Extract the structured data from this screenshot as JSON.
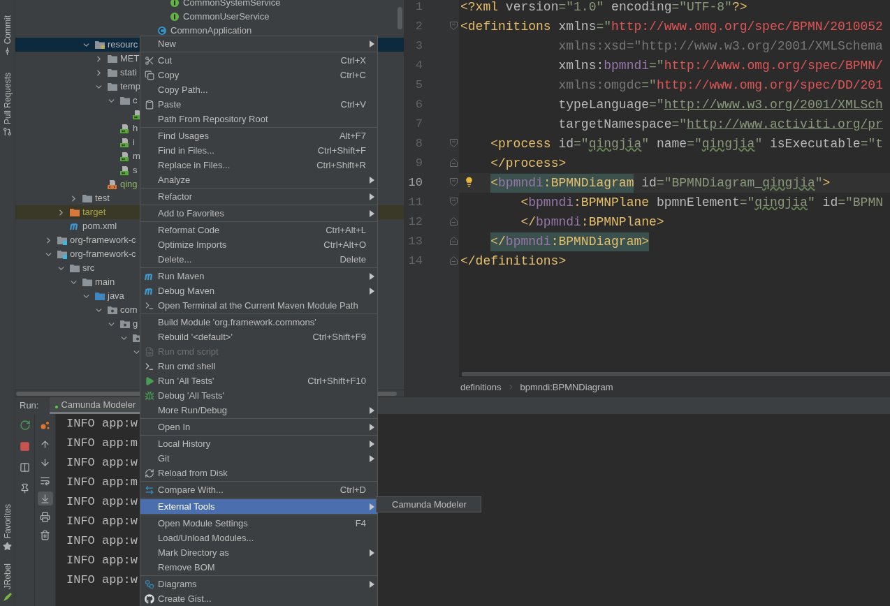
{
  "tool_windows": {
    "top": [
      "Commit",
      "Pull Requests"
    ],
    "bottom": [
      "Favorites",
      "JRebel"
    ]
  },
  "tree": {
    "items": [
      {
        "children": [
          {
            "children": [
              {
                "children": [
                  {
                    "children": [
                      {
                        "children": [
                          {
                            "children": [
                              {
                                "children": [
                                  {
                                    "children": [
                                      {
                                        "children": [
                                          {
                                            "text": "CommonSystemService",
                                            "kind": "interface",
                                            "selected": false
                                          },
                                          {
                                            "text": "CommonUserService",
                                            "kind": "interface",
                                            "selected": false
                                          }
                                        ]
                                      },
                                      {
                                        "text": "CommonApplication",
                                        "kind": "class",
                                        "selected": false
                                      }
                                    ]
                                  }
                                ]
                              }
                            ]
                          }
                        ]
                      }
                    ]
                  },
                  {
                    "text": "resourc",
                    "kind": "resources",
                    "expanded": true,
                    "selected": true,
                    "children": [
                      {
                        "text": "MET",
                        "kind": "folder",
                        "expanded": false,
                        "selected": false
                      },
                      {
                        "text": "stati",
                        "kind": "folder",
                        "expanded": false,
                        "selected": false
                      },
                      {
                        "text": "temp",
                        "kind": "folder",
                        "expanded": true,
                        "selected": false,
                        "children": [
                          {
                            "text": "c",
                            "kind": "folder",
                            "expanded": true,
                            "selected": false,
                            "children": [
                              {
                                "kind": "html",
                                "selected": false
                              }
                            ]
                          },
                          {
                            "text": "h",
                            "kind": "html",
                            "selected": false
                          },
                          {
                            "text": "i",
                            "kind": "html",
                            "selected": false
                          },
                          {
                            "text": "m",
                            "kind": "html",
                            "selected": false
                          },
                          {
                            "text": "s",
                            "kind": "html",
                            "selected": false
                          }
                        ]
                      },
                      {
                        "text": "qing",
                        "kind": "xml",
                        "color": "#8fb36a",
                        "selected": false
                      }
                    ]
                  }
                ]
              },
              {
                "text": "test",
                "kind": "folder",
                "expanded": false,
                "selected": false
              }
            ]
          },
          {
            "text": "target",
            "kind": "excluded",
            "expanded": false,
            "selected": false
          },
          {
            "text": "pom.xml",
            "kind": "maven",
            "selected": false
          }
        ]
      },
      {
        "text": "org-framework-c",
        "kind": "module",
        "expanded": false,
        "selected": false
      },
      {
        "text": "org-framework-c",
        "kind": "module",
        "expanded": true,
        "selected": false,
        "children": [
          {
            "text": "src",
            "kind": "folder",
            "expanded": true,
            "selected": false,
            "children": [
              {
                "text": "main",
                "kind": "folder",
                "expanded": true,
                "selected": false,
                "children": [
                  {
                    "text": "java",
                    "kind": "source",
                    "expanded": true,
                    "selected": false,
                    "children": [
                      {
                        "text": "com",
                        "kind": "package",
                        "expanded": true,
                        "selected": false,
                        "children": [
                          {
                            "text": "g",
                            "kind": "package",
                            "expanded": true,
                            "selected": false,
                            "children": [
                              {
                                "kind": "package",
                                "expanded": true,
                                "selected": false,
                                "children": [
                                  {
                                    "expanded": true,
                                    "selected": false
                                  }
                                ]
                              }
                            ]
                          }
                        ]
                      }
                    ]
                  }
                ]
              }
            ]
          }
        ]
      }
    ]
  },
  "editor": {
    "lines": [
      {
        "number": "1",
        "fold_open": false,
        "fold_close": false,
        "current": false,
        "bulb": false,
        "tokens": [
          {
            "text": "<?xml",
            "kind": "tag"
          },
          {
            "text": " version",
            "kind": "attr"
          },
          {
            "text": "=\"1.0\"",
            "kind": "value"
          },
          {
            "text": " encoding",
            "kind": "attr"
          },
          {
            "text": "=\"UTF-8\"",
            "kind": "value"
          },
          {
            "text": "?>",
            "kind": "tag"
          }
        ]
      },
      {
        "number": "2",
        "fold_open": true,
        "fold_close": false,
        "current": false,
        "bulb": false,
        "tokens": [
          {
            "text": "<definitions",
            "kind": "tag"
          },
          {
            "text": " xmlns",
            "kind": "attr"
          },
          {
            "text": "=\"",
            "kind": "value"
          },
          {
            "text": "http://www.omg.org/spec/BPMN/2010052",
            "kind": "url_error"
          }
        ]
      },
      {
        "number": "3",
        "fold_open": false,
        "fold_close": false,
        "current": false,
        "bulb": false,
        "tokens": [
          {
            "text": "             xmlns:xsd=\"http://www.w3.org/2001/XMLSchema",
            "kind": "unused"
          }
        ]
      },
      {
        "number": "4",
        "fold_open": false,
        "fold_close": false,
        "current": false,
        "bulb": false,
        "tokens": [
          {
            "text": "             xmlns:",
            "kind": "attr"
          },
          {
            "text": "bpmndi",
            "kind": "ns"
          },
          {
            "text": "=\"",
            "kind": "value"
          },
          {
            "text": "http://www.omg.org/spec/BPMN/",
            "kind": "url_error"
          }
        ]
      },
      {
        "number": "5",
        "fold_open": false,
        "fold_close": false,
        "current": false,
        "bulb": false,
        "tokens": [
          {
            "text": "             xmlns:omgdc",
            "kind": "unused"
          },
          {
            "text": "=\"",
            "kind": "value"
          },
          {
            "text": "http://www.omg.org/spec/DD/201",
            "kind": "url_error"
          }
        ]
      },
      {
        "number": "6",
        "fold_open": false,
        "fold_close": false,
        "current": false,
        "bulb": false,
        "tokens": [
          {
            "text": "             typeLanguage",
            "kind": "attr"
          },
          {
            "text": "=\"",
            "kind": "value"
          },
          {
            "text": "http://www.w3.org/2001/XMLSch",
            "kind": "link"
          }
        ]
      },
      {
        "number": "7",
        "fold_open": false,
        "fold_close": false,
        "current": false,
        "bulb": false,
        "tokens": [
          {
            "text": "             targetNamespace",
            "kind": "attr"
          },
          {
            "text": "=\"",
            "kind": "value"
          },
          {
            "text": "http://www.activiti.org/pr",
            "kind": "link"
          }
        ]
      },
      {
        "number": "8",
        "fold_open": true,
        "fold_close": false,
        "current": false,
        "bulb": false,
        "tokens": [
          {
            "text": "    <process",
            "kind": "tag"
          },
          {
            "text": " id",
            "kind": "attr"
          },
          {
            "text": "=\"",
            "kind": "value"
          },
          {
            "text": "qingjia",
            "kind": "typo"
          },
          {
            "text": "\"",
            "kind": "value"
          },
          {
            "text": " name",
            "kind": "attr"
          },
          {
            "text": "=\"",
            "kind": "value"
          },
          {
            "text": "qingjia",
            "kind": "typo"
          },
          {
            "text": "\"",
            "kind": "value"
          },
          {
            "text": " isExecutable",
            "kind": "attr"
          },
          {
            "text": "=\"t",
            "kind": "value"
          }
        ]
      },
      {
        "number": "9",
        "fold_open": false,
        "fold_close": true,
        "current": false,
        "bulb": false,
        "tokens": [
          {
            "text": "    </process>",
            "kind": "tag"
          }
        ]
      },
      {
        "number": "10",
        "fold_open": true,
        "fold_close": false,
        "current": true,
        "bulb": true,
        "tokens": [
          {
            "text": "    <",
            "kind": "tag_match"
          },
          {
            "text": "bpmndi",
            "kind": "ns_match"
          },
          {
            "text": ":BPMNDiagram",
            "kind": "tag_match"
          },
          {
            "text": " id",
            "kind": "attr"
          },
          {
            "text": "=\"BPMNDiagram_",
            "kind": "value"
          },
          {
            "text": "qingjia",
            "kind": "typo"
          },
          {
            "text": "\"",
            "kind": "value"
          },
          {
            "text": ">",
            "kind": "tag"
          }
        ]
      },
      {
        "number": "11",
        "fold_open": true,
        "fold_close": false,
        "current": false,
        "bulb": false,
        "tokens": [
          {
            "text": "        <",
            "kind": "tag"
          },
          {
            "text": "bpmndi",
            "kind": "ns"
          },
          {
            "text": ":BPMNPlane",
            "kind": "tag"
          },
          {
            "text": " bpmnElement",
            "kind": "attr"
          },
          {
            "text": "=\"",
            "kind": "value"
          },
          {
            "text": "qingjia",
            "kind": "typo"
          },
          {
            "text": "\"",
            "kind": "value"
          },
          {
            "text": " id",
            "kind": "attr"
          },
          {
            "text": "=\"BPMN",
            "kind": "value"
          }
        ]
      },
      {
        "number": "12",
        "fold_open": false,
        "fold_close": true,
        "current": false,
        "bulb": false,
        "tokens": [
          {
            "text": "        </",
            "kind": "tag"
          },
          {
            "text": "bpmndi",
            "kind": "ns"
          },
          {
            "text": ":BPMNPlane>",
            "kind": "tag"
          }
        ]
      },
      {
        "number": "13",
        "fold_open": false,
        "fold_close": true,
        "current": false,
        "bulb": false,
        "tokens": [
          {
            "text": "    </",
            "kind": "tag_match"
          },
          {
            "text": "bpmndi",
            "kind": "ns_match"
          },
          {
            "text": ":BPMNDiagram>",
            "kind": "tag_match"
          }
        ]
      },
      {
        "number": "14",
        "fold_open": false,
        "fold_close": true,
        "current": false,
        "bulb": false,
        "tokens": [
          {
            "text": "</definitions>",
            "kind": "tag"
          }
        ]
      }
    ]
  },
  "breadcrumb": [
    "definitions",
    "bpmndi:BPMNDiagram"
  ],
  "run": {
    "label": "Run:",
    "tabs": [
      {
        "label": "Camunda Modeler",
        "selected": true
      }
    ],
    "tools": [
      {
        "on": false
      },
      {
        "on": false
      },
      {
        "on": false
      },
      {
        "on": false
      },
      {
        "on": true
      },
      {
        "on": false
      },
      {
        "on": false
      }
    ],
    "console": [
      "INFO app:w",
      "INFO app:m",
      "INFO app:w",
      "INFO app:m",
      "INFO app:w",
      "INFO app:w",
      "INFO app:w",
      "INFO app:w",
      "INFO app:w"
    ]
  },
  "menu": {
    "groups": [
      {
        "items": [
          {
            "label": "New",
            "submenu": true,
            "disabled": false,
            "selected": false
          }
        ]
      },
      {
        "items": [
          {
            "label": "Cut",
            "shortcut": "Ctrl+X",
            "submenu": false,
            "disabled": false,
            "selected": false
          },
          {
            "label": "Copy",
            "shortcut": "Ctrl+C",
            "submenu": false,
            "disabled": false,
            "selected": false
          },
          {
            "label": "Copy Path...",
            "submenu": false,
            "disabled": false,
            "selected": false
          },
          {
            "label": "Paste",
            "shortcut": "Ctrl+V",
            "submenu": false,
            "disabled": false,
            "selected": false
          },
          {
            "label": "Path From Repository Root",
            "submenu": false,
            "disabled": false,
            "selected": false
          }
        ]
      },
      {
        "items": [
          {
            "label": "Find Usages",
            "shortcut": "Alt+F7",
            "submenu": false,
            "disabled": false,
            "selected": false
          },
          {
            "label": "Find in Files...",
            "shortcut": "Ctrl+Shift+F",
            "submenu": false,
            "disabled": false,
            "selected": false
          },
          {
            "label": "Replace in Files...",
            "shortcut": "Ctrl+Shift+R",
            "submenu": false,
            "disabled": false,
            "selected": false
          },
          {
            "label": "Analyze",
            "submenu": true,
            "disabled": false,
            "selected": false
          }
        ]
      },
      {
        "items": [
          {
            "label": "Refactor",
            "submenu": true,
            "disabled": false,
            "selected": false
          }
        ]
      },
      {
        "items": [
          {
            "label": "Add to Favorites",
            "submenu": true,
            "disabled": false,
            "selected": false
          }
        ]
      },
      {
        "items": [
          {
            "label": "Reformat Code",
            "shortcut": "Ctrl+Alt+L",
            "submenu": false,
            "disabled": false,
            "selected": false
          },
          {
            "label": "Optimize Imports",
            "shortcut": "Ctrl+Alt+O",
            "submenu": false,
            "disabled": false,
            "selected": false
          },
          {
            "label": "Delete...",
            "shortcut": "Delete",
            "submenu": false,
            "disabled": false,
            "selected": false
          }
        ]
      },
      {
        "items": [
          {
            "label": "Run Maven",
            "submenu": true,
            "disabled": false,
            "selected": false
          },
          {
            "label": "Debug Maven",
            "submenu": true,
            "disabled": false,
            "selected": false
          },
          {
            "label": "Open Terminal at the Current Maven Module Path",
            "submenu": false,
            "disabled": false,
            "selected": false
          }
        ]
      },
      {
        "items": [
          {
            "label": "Build Module 'org.framework.commons'",
            "submenu": false,
            "disabled": false,
            "selected": false
          },
          {
            "label": "Rebuild '<default>'",
            "shortcut": "Ctrl+Shift+F9",
            "submenu": false,
            "disabled": false,
            "selected": false
          },
          {
            "label": "Run cmd script",
            "submenu": false,
            "disabled": true,
            "selected": false
          },
          {
            "label": "Run cmd shell",
            "submenu": false,
            "disabled": false,
            "selected": false
          },
          {
            "label": "Run 'All Tests'",
            "shortcut": "Ctrl+Shift+F10",
            "submenu": false,
            "disabled": false,
            "selected": false
          },
          {
            "label": "Debug 'All Tests'",
            "submenu": false,
            "disabled": false,
            "selected": false
          },
          {
            "label": "More Run/Debug",
            "submenu": true,
            "disabled": false,
            "selected": false
          }
        ]
      },
      {
        "items": [
          {
            "label": "Open In",
            "submenu": true,
            "disabled": false,
            "selected": false
          }
        ]
      },
      {
        "items": [
          {
            "label": "Local History",
            "submenu": true,
            "disabled": false,
            "selected": false
          },
          {
            "label": "Git",
            "submenu": true,
            "disabled": false,
            "selected": false
          },
          {
            "label": "Reload from Disk",
            "submenu": false,
            "disabled": false,
            "selected": false
          }
        ]
      },
      {
        "items": [
          {
            "label": "Compare With...",
            "shortcut": "Ctrl+D",
            "submenu": false,
            "disabled": false,
            "selected": false
          }
        ]
      },
      {
        "items": [
          {
            "label": "External Tools",
            "submenu": true,
            "disabled": false,
            "selected": true
          }
        ]
      },
      {
        "items": [
          {
            "label": "Open Module Settings",
            "shortcut": "F4",
            "submenu": false,
            "disabled": false,
            "selected": false
          },
          {
            "label": "Load/Unload Modules...",
            "submenu": false,
            "disabled": false,
            "selected": false
          },
          {
            "label": "Mark Directory as",
            "submenu": true,
            "disabled": false,
            "selected": false
          },
          {
            "label": "Remove BOM",
            "submenu": false,
            "disabled": false,
            "selected": false
          }
        ]
      },
      {
        "items": [
          {
            "label": "Diagrams",
            "submenu": true,
            "disabled": false,
            "selected": false
          },
          {
            "label": "Create Gist...",
            "submenu": false,
            "disabled": false,
            "selected": false
          }
        ]
      }
    ]
  },
  "submenu": {
    "items": [
      {
        "label": "Camunda Modeler",
        "selected": false
      }
    ]
  }
}
